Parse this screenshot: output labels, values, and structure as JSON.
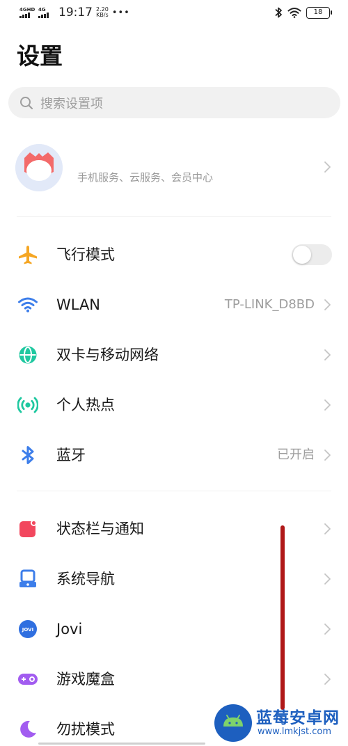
{
  "status_bar": {
    "sim1_label": "4GHD",
    "sim2_label": "4G",
    "time": "19:17",
    "net_speed_value": "2.20",
    "net_speed_unit": "KB/s",
    "more_dots": "•••",
    "battery_level": "18"
  },
  "header": {
    "title": "设置"
  },
  "search": {
    "placeholder": "搜索设置项"
  },
  "account": {
    "subtitle": "手机服务、云服务、会员中心"
  },
  "connectivity": {
    "airplane": {
      "label": "飞行模式",
      "enabled": false
    },
    "wlan": {
      "label": "WLAN",
      "value": "TP-LINK_D8BD"
    },
    "dual_sim": {
      "label": "双卡与移动网络"
    },
    "hotspot": {
      "label": "个人热点"
    },
    "bluetooth": {
      "label": "蓝牙",
      "value": "已开启"
    }
  },
  "system": {
    "status_bar_notifications": {
      "label": "状态栏与通知"
    },
    "navigation": {
      "label": "系统导航"
    },
    "jovi": {
      "label": "Jovi",
      "icon_text": "JOVI"
    },
    "game_box": {
      "label": "游戏魔盒"
    },
    "do_not_disturb": {
      "label": "勿扰模式"
    }
  },
  "watermark": {
    "title": "蓝莓安卓网",
    "url": "www.lmkjst.com"
  },
  "colors": {
    "airplane": "#f5a623",
    "wlan": "#3d7eea",
    "globe": "#1fc8a0",
    "hotspot": "#1fc8a0",
    "bluetooth": "#3d7eea",
    "status_notif": "#f2475e",
    "navigation": "#3d7eea",
    "jovi": "#2f6fe0",
    "game_box": "#a25cf0",
    "do_not_disturb": "#a25cf0",
    "annotation": "#b01818"
  }
}
